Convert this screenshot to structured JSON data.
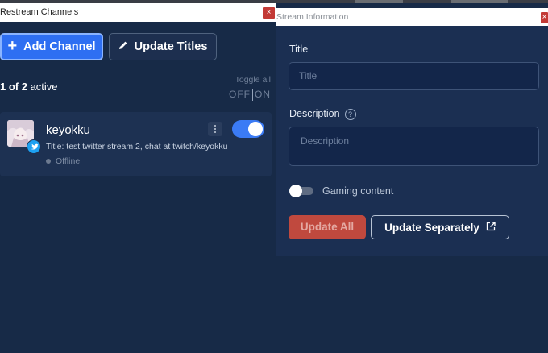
{
  "colors": {
    "accent_blue": "#2e6ff2",
    "toggle_on": "#3b7bf5",
    "update_all_red": "#c0493e",
    "close_red": "#c33a36",
    "twitter_blue": "#1da1f2"
  },
  "left_window": {
    "title": "Restream Channels",
    "close_glyph": "×",
    "add_channel_label": "Add Channel",
    "update_titles_label": "Update Titles",
    "active": {
      "count": "1 of 2",
      "suffix": " active"
    },
    "toggle_all": {
      "label": "Toggle all",
      "off": "OFF",
      "on": "ON"
    },
    "channels": [
      {
        "name": "keyokku",
        "title": "Title: test twitter stream 2, chat at twitch/keyokku",
        "status": "Offline",
        "platform_icon": "twitter-icon",
        "enabled": true
      }
    ]
  },
  "right_window": {
    "title": "Stream Information",
    "title_label": "Title",
    "title_placeholder": "Title",
    "description_label": "Description",
    "description_placeholder": "Description",
    "gaming_label": "Gaming content",
    "gaming_enabled": false,
    "update_all_label": "Update All",
    "update_separately_label": "Update Separately"
  }
}
